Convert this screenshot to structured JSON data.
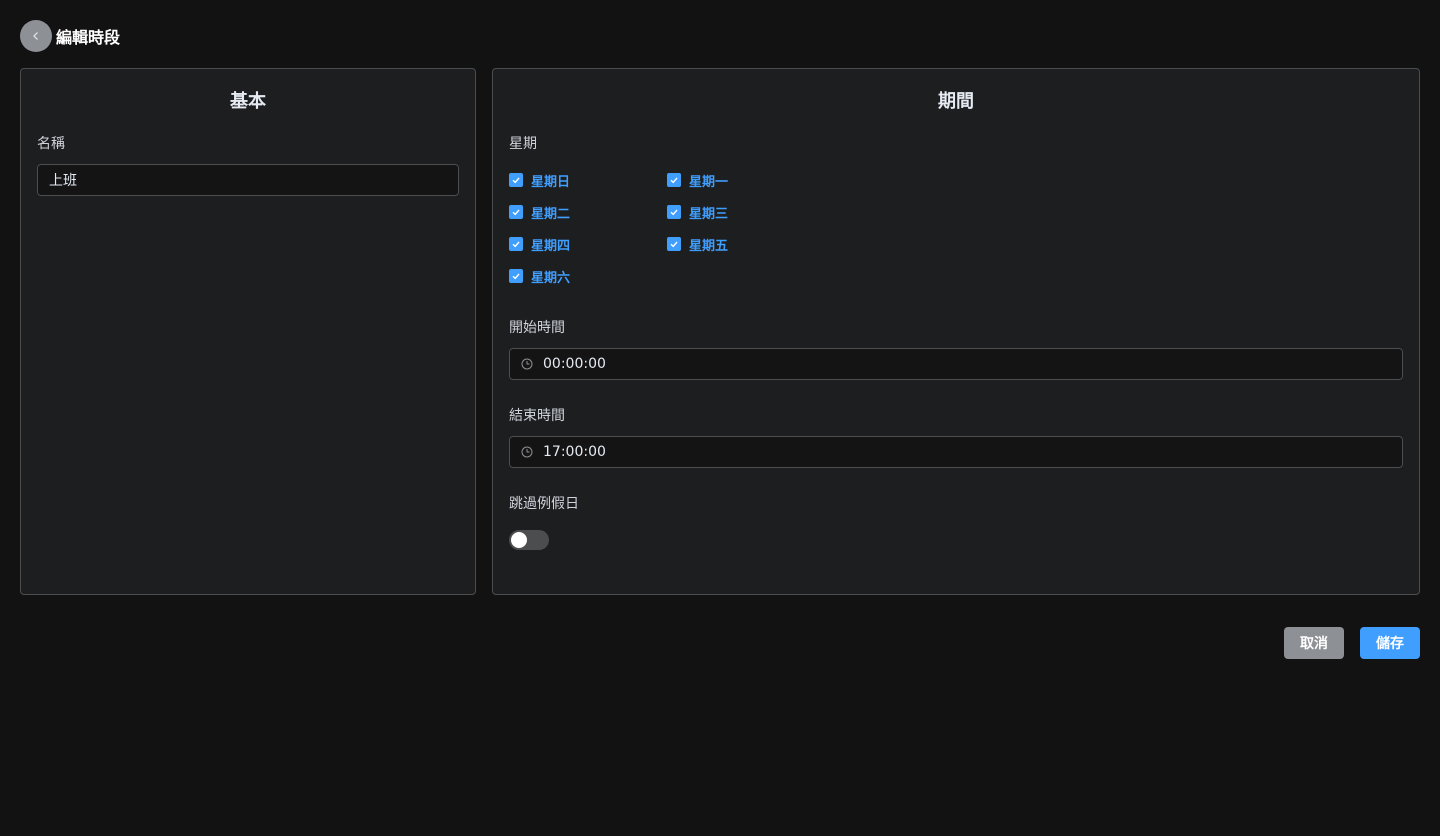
{
  "header": {
    "title": "編輯時段"
  },
  "basic": {
    "title": "基本",
    "name_label": "名稱",
    "name_value": "上班"
  },
  "period": {
    "title": "期間",
    "weekday_label": "星期",
    "weekdays": [
      {
        "label": "星期日",
        "checked": true
      },
      {
        "label": "星期一",
        "checked": true
      },
      {
        "label": "星期二",
        "checked": true
      },
      {
        "label": "星期三",
        "checked": true
      },
      {
        "label": "星期四",
        "checked": true
      },
      {
        "label": "星期五",
        "checked": true
      },
      {
        "label": "星期六",
        "checked": true
      }
    ],
    "start_label": "開始時間",
    "start_value": "00:00:00",
    "end_label": "結束時間",
    "end_value": "17:00:00",
    "skip_holiday_label": "跳過例假日",
    "skip_holiday_on": false
  },
  "actions": {
    "cancel": "取消",
    "save": "儲存"
  },
  "colors": {
    "accent": "#409eff",
    "background": "#121212",
    "card": "#1d1e1f",
    "muted_button": "#8d9095"
  }
}
